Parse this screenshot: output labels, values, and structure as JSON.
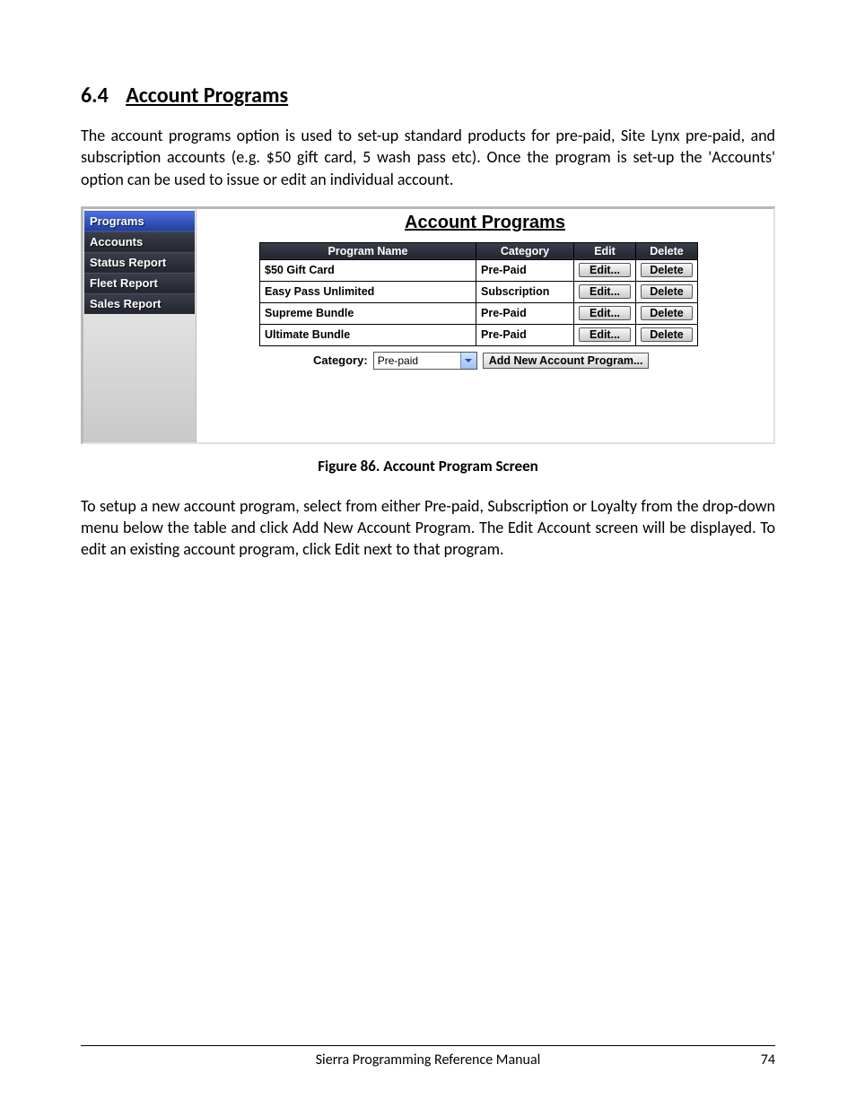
{
  "heading": {
    "number": "6.4",
    "title": " Account Programs"
  },
  "para1": "The account programs option is used to set-up standard products for pre-paid, Site Lynx pre-paid, and subscription accounts (e.g. $50 gift card, 5 wash pass etc). Once the program is set-up the 'Accounts' option can be used to issue or edit an individual account.",
  "sidebar": {
    "items": [
      {
        "label": "Programs",
        "selected": true
      },
      {
        "label": "Accounts",
        "selected": false
      },
      {
        "label": "Status Report",
        "selected": false
      },
      {
        "label": "Fleet Report",
        "selected": false
      },
      {
        "label": "Sales Report",
        "selected": false
      }
    ]
  },
  "content": {
    "title": "Account Programs",
    "columns": {
      "name": "Program Name",
      "category": "Category",
      "edit": "Edit",
      "delete": "Delete"
    },
    "rows": [
      {
        "name": "$50 Gift Card",
        "category": "Pre-Paid",
        "edit": "Edit...",
        "delete": "Delete"
      },
      {
        "name": "Easy Pass Unlimited",
        "category": "Subscription",
        "edit": "Edit...",
        "delete": "Delete"
      },
      {
        "name": "Supreme Bundle",
        "category": "Pre-Paid",
        "edit": "Edit...",
        "delete": "Delete"
      },
      {
        "name": "Ultimate Bundle",
        "category": "Pre-Paid",
        "edit": "Edit...",
        "delete": "Delete"
      }
    ],
    "category_label": "Category:",
    "category_value": "Pre-paid",
    "add_button": "Add New Account Program..."
  },
  "caption": "Figure 86. Account Program Screen",
  "para2": "To setup a new account program, select from either Pre-paid, Subscription or Loyalty from the drop-down menu below the table and click Add New Account Program. The Edit Account screen will be displayed. To edit an existing account program, click Edit next to that program.",
  "footer": {
    "title": "Sierra Programming Reference Manual",
    "page": "74"
  }
}
